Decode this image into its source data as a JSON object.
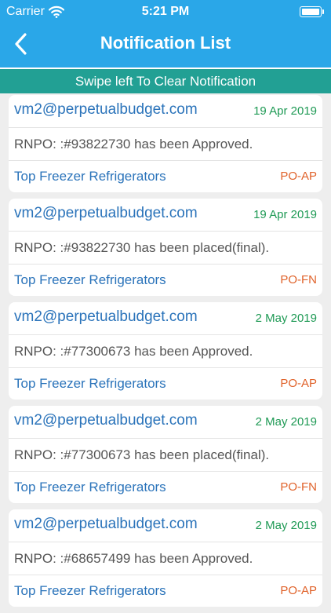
{
  "status_bar": {
    "carrier": "Carrier",
    "time": "5:21 PM"
  },
  "nav": {
    "title": "Notification List",
    "back_icon": "chevron-left-icon"
  },
  "banner": {
    "text": "Swipe left To Clear Notification"
  },
  "colors": {
    "header": "#2aa7e8",
    "banner": "#22a094",
    "email": "#2a73ba",
    "date": "#1f9a55",
    "code": "#e0622a"
  },
  "notifications": [
    {
      "email": "vm2@perpetualbudget.com",
      "date": "19 Apr 2019",
      "message": "RNPO: :#93822730 has been Approved.",
      "category": "Top Freezer Refrigerators",
      "code": "PO-AP"
    },
    {
      "email": "vm2@perpetualbudget.com",
      "date": "19 Apr 2019",
      "message": "RNPO: :#93822730 has been placed(final).",
      "category": "Top Freezer Refrigerators",
      "code": "PO-FN"
    },
    {
      "email": "vm2@perpetualbudget.com",
      "date": "2 May 2019",
      "message": "RNPO: :#77300673 has been Approved.",
      "category": "Top Freezer Refrigerators",
      "code": "PO-AP"
    },
    {
      "email": "vm2@perpetualbudget.com",
      "date": "2 May 2019",
      "message": "RNPO: :#77300673 has been placed(final).",
      "category": "Top Freezer Refrigerators",
      "code": "PO-FN"
    },
    {
      "email": "vm2@perpetualbudget.com",
      "date": "2 May 2019",
      "message": "RNPO: :#68657499 has been Approved.",
      "category": "Top Freezer Refrigerators",
      "code": "PO-AP"
    }
  ]
}
